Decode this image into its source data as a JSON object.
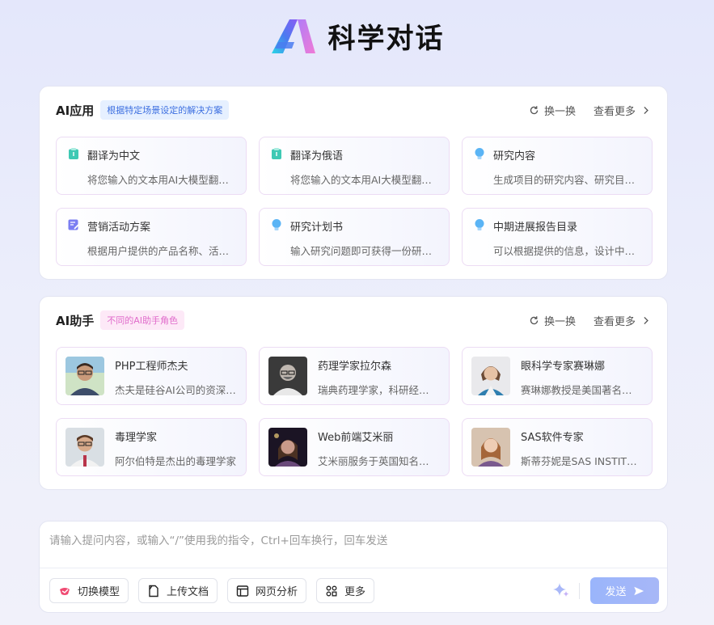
{
  "brand": {
    "title": "科学对话",
    "logo_icon": "ai-logo-icon"
  },
  "apps_panel": {
    "title": "AI应用",
    "badge": "根据特定场景设定的解决方案",
    "refresh_label": "换一换",
    "more_label": "查看更多",
    "cards": [
      {
        "icon": "clipboard-icon",
        "title": "翻译为中文",
        "desc": "将您输入的文本用AI大模型翻译为中文"
      },
      {
        "icon": "clipboard-icon",
        "title": "翻译为俄语",
        "desc": "将您输入的文本用AI大模型翻译为俄语"
      },
      {
        "icon": "lightbulb-icon",
        "title": "研究内容",
        "desc": "生成项目的研究内容、研究目标和方法"
      },
      {
        "icon": "edit-doc-icon",
        "title": "营销活动方案",
        "desc": "根据用户提供的产品名称、活动目标生成方案"
      },
      {
        "icon": "lightbulb-icon",
        "title": "研究计划书",
        "desc": "输入研究问题即可获得一份研究计划书"
      },
      {
        "icon": "lightbulb-icon",
        "title": "中期进展报告目录",
        "desc": "可以根据提供的信息，设计中期进展报告目录"
      }
    ]
  },
  "assistants_panel": {
    "title": "AI助手",
    "badge": "不同的AI助手角色",
    "refresh_label": "换一换",
    "more_label": "查看更多",
    "cards": [
      {
        "avatar": "avatar-photo",
        "title": "PHP工程师杰夫",
        "desc": "杰夫是硅谷AI公司的资深PHP工程师"
      },
      {
        "avatar": "avatar-photo",
        "title": "药理学家拉尔森",
        "desc": "瑞典药理学家，科研经验丰富"
      },
      {
        "avatar": "avatar-photo",
        "title": "眼科学专家赛琳娜",
        "desc": "赛琳娜教授是美国著名眼科学专家"
      },
      {
        "avatar": "avatar-photo",
        "title": "毒理学家",
        "desc": "阿尔伯特是杰出的毒理学家"
      },
      {
        "avatar": "avatar-photo",
        "title": "Web前端艾米丽",
        "desc": "艾米丽服务于英国知名互联网公司"
      },
      {
        "avatar": "avatar-photo",
        "title": "SAS软件专家",
        "desc": "斯蒂芬妮是SAS INSTITUTE的专家"
      }
    ]
  },
  "composer": {
    "placeholder": "请输入提问内容，或输入“/”使用我的指令，Ctrl+回车换行，回车发送",
    "tools": [
      {
        "icon": "model-switch-icon",
        "label": "切换模型"
      },
      {
        "icon": "document-icon",
        "label": "上传文档"
      },
      {
        "icon": "webpage-icon",
        "label": "网页分析"
      },
      {
        "icon": "grid-more-icon",
        "label": "更多"
      }
    ],
    "send_label": "发送"
  },
  "colors": {
    "accent": "#3d6fe0",
    "pink": "#e06bcb",
    "send": "#9ab5fb"
  }
}
